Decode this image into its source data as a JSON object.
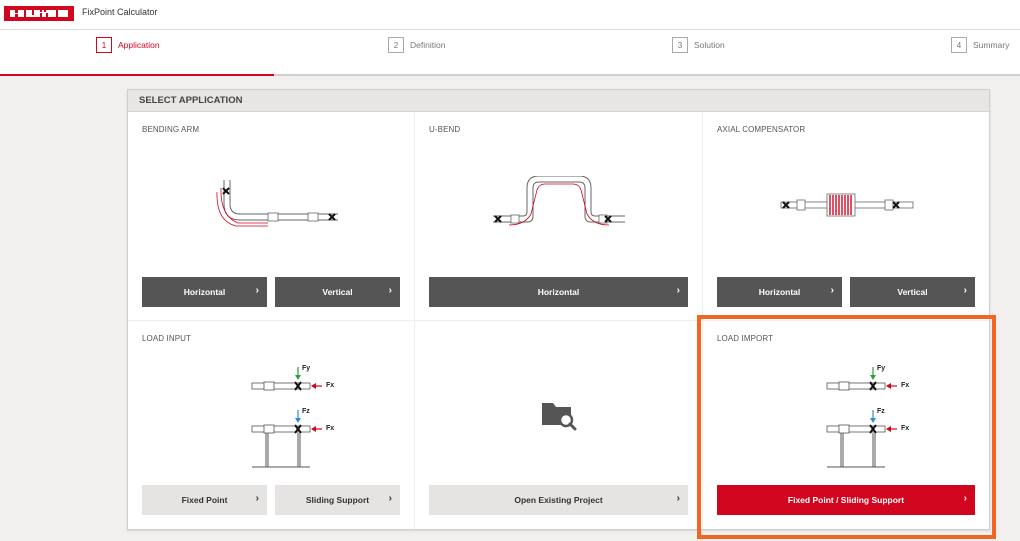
{
  "header": {
    "logo_text": "HILTI",
    "app_title": "FixPoint Calculator"
  },
  "steps": [
    {
      "num": "1",
      "label": "Application"
    },
    {
      "num": "2",
      "label": "Definition"
    },
    {
      "num": "3",
      "label": "Solution"
    },
    {
      "num": "4",
      "label": "Summary"
    }
  ],
  "active_step": "Application",
  "panel": {
    "title": "SELECT APPLICATION",
    "cards": {
      "bending_arm": {
        "title": "BENDING ARM",
        "buttons": [
          "Horizontal",
          "Vertical"
        ]
      },
      "u_bend": {
        "title": "U-BEND",
        "buttons": [
          "Horizontal"
        ]
      },
      "axial": {
        "title": "AXIAL COMPENSATOR",
        "buttons": [
          "Horizontal",
          "Vertical"
        ]
      },
      "load_input": {
        "title": "LOAD INPUT",
        "buttons": [
          "Fixed Point",
          "Sliding Support"
        ]
      },
      "open_project": {
        "buttons": [
          "Open Existing Project"
        ]
      },
      "load_import": {
        "title": "LOAD IMPORT",
        "buttons": [
          "Fixed Point / Sliding Support"
        ]
      }
    }
  },
  "force_labels": {
    "fy": "Fy",
    "fx": "Fx",
    "fz": "Fz"
  },
  "icons": {
    "chevron": "chevron-right-icon",
    "folder": "folder-search-icon"
  },
  "colors": {
    "brand_red": "#d2051e",
    "dark_button": "#555555",
    "light_button": "#e5e4e2",
    "highlight": "#f26522"
  }
}
